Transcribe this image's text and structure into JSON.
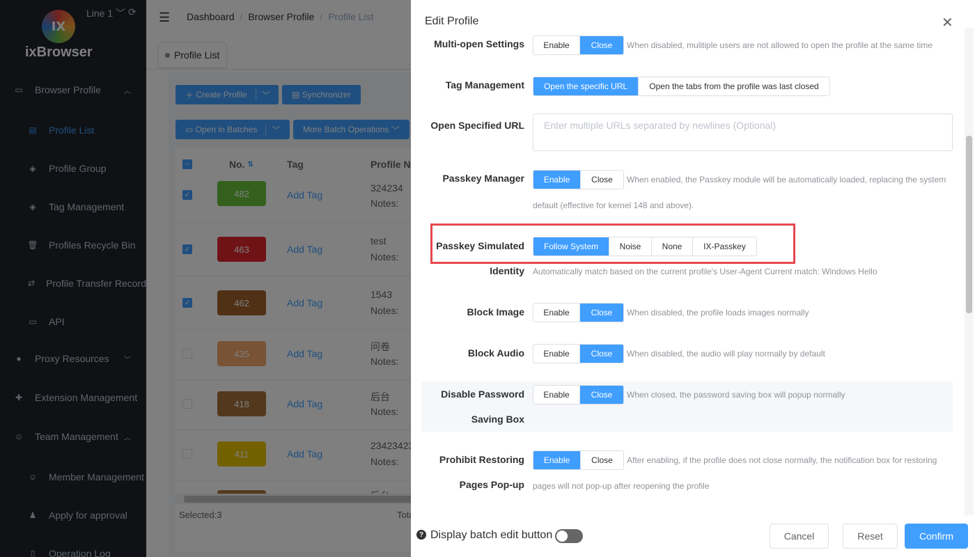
{
  "sidebar": {
    "logo_text": "IX",
    "brand": "ixBrowser",
    "line": "Line 1",
    "items": [
      {
        "label": "Browser Profile",
        "icon": "window-icon"
      },
      {
        "label": "Profile List",
        "icon": "list-icon"
      },
      {
        "label": "Profile Group",
        "icon": "layers-icon"
      },
      {
        "label": "Tag Management",
        "icon": "tag-icon"
      },
      {
        "label": "Profiles Recycle Bin",
        "icon": "trash-icon"
      },
      {
        "label": "Profile Transfer Record",
        "icon": "transfer-icon"
      },
      {
        "label": "API",
        "icon": "api-icon"
      },
      {
        "label": "Proxy Resources",
        "icon": "globe-icon"
      },
      {
        "label": "Extension Management",
        "icon": "puzzle-icon"
      },
      {
        "label": "Team Management",
        "icon": "user-icon"
      },
      {
        "label": "Member Management",
        "icon": "member-icon"
      },
      {
        "label": "Apply for approval",
        "icon": "approval-icon"
      },
      {
        "label": "Operation Log",
        "icon": "log-icon"
      }
    ]
  },
  "breadcrumb": [
    "Dashboard",
    "Browser Profile",
    "Profile List"
  ],
  "tab": "Profile List",
  "toolbar": {
    "create": "Create Profile",
    "sync": "Synchronizer",
    "open_batches": "Open in Batches",
    "more_batch": "More Batch Operations"
  },
  "table": {
    "headers": {
      "no": "No.",
      "tag": "Tag",
      "name": "Profile Nar"
    },
    "rows": [
      {
        "no": "482",
        "color": "#67c23a",
        "tag": "Add Tag",
        "name": "324234",
        "notes": "Notes:",
        "checked": true
      },
      {
        "no": "463",
        "color": "#e0262f",
        "tag": "Add Tag",
        "name": "test",
        "notes": "Notes:",
        "checked": true
      },
      {
        "no": "462",
        "color": "#a0622c",
        "tag": "Add Tag",
        "name": "1543",
        "notes": "Notes:",
        "checked": true
      },
      {
        "no": "435",
        "color": "#f0a76a",
        "tag": "Add Tag",
        "name": "问卷",
        "notes": "Notes:",
        "checked": false
      },
      {
        "no": "418",
        "color": "#a8703a",
        "tag": "Add Tag",
        "name": "后台",
        "notes": "Notes:",
        "checked": false
      },
      {
        "no": "411",
        "color": "#e6c200",
        "tag": "Add Tag",
        "name": "23423423",
        "notes": "Notes:",
        "checked": false
      },
      {
        "no": "",
        "color": "#a8703a",
        "tag": "",
        "name": "后台",
        "notes": "",
        "checked": false
      }
    ],
    "selected": "Selected:3",
    "total": "Total"
  },
  "drawer": {
    "title": "Edit Profile",
    "multi_open": {
      "label": "Multi-open Settings",
      "options": [
        "Enable",
        "Close"
      ],
      "hint": "When disabled, mulitiple users are not allowed to open the profile at the same time"
    },
    "tag_mgmt": {
      "label": "Tag Management",
      "options": [
        "Open the specific URL",
        "Open the tabs from the profile was last closed"
      ]
    },
    "open_url": {
      "label": "Open Specified URL",
      "placeholder": "Enter multiple URLs separated by newlines (Optional)"
    },
    "passkey_mgr": {
      "label": "Passkey Manager",
      "options": [
        "Enable",
        "Close"
      ],
      "hint1": "When enabled, the Passkey module will be automatically loaded, replacing the system",
      "hint2": "default (effective for kernel 148 and above)."
    },
    "passkey_sim": {
      "label": "Passkey Simulated",
      "label2": "Identity",
      "options": [
        "Follow System",
        "Noise",
        "None",
        "IX-Passkey"
      ],
      "hint": "Automatically match based on the current profile's User-Agent Current match: Windows Hello"
    },
    "block_image": {
      "label": "Block Image",
      "options": [
        "Enable",
        "Close"
      ],
      "hint": "When disabled, the profile loads images normally"
    },
    "block_audio": {
      "label": "Block Audio",
      "options": [
        "Enable",
        "Close"
      ],
      "hint": "When disabled, the audio will play normally by default"
    },
    "disable_pwd": {
      "label": "Disable Password",
      "label2": "Saving Box",
      "options": [
        "Enable",
        "Close"
      ],
      "hint": "When closed, the password saving box will popup normally"
    },
    "prohibit": {
      "label": "Prohibit Restoring",
      "label2": "Pages Pop-up",
      "options": [
        "Enable",
        "Close"
      ],
      "hint1": "After enabling, if the profile does not close normally, the notification box for restoring",
      "hint2": "pages will not pop-up after reopening the profile"
    },
    "footer": {
      "batch_label": "Display batch edit button",
      "cancel": "Cancel",
      "reset": "Reset",
      "confirm": "Confirm"
    }
  }
}
